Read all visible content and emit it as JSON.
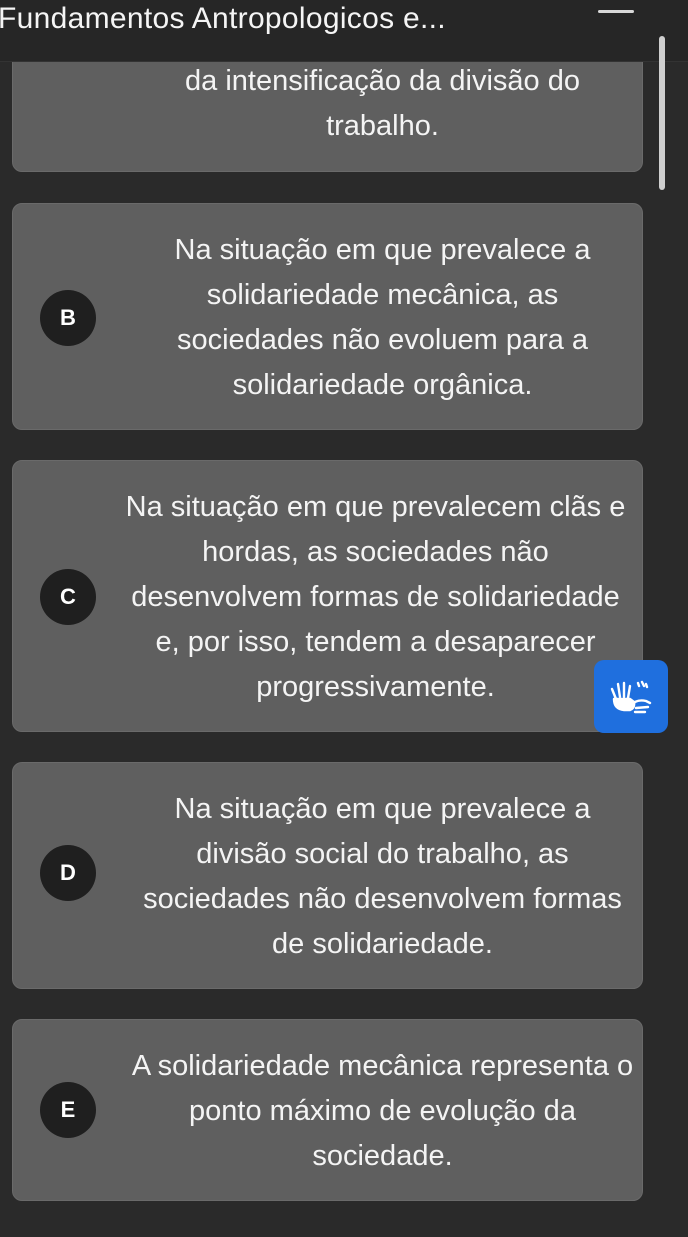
{
  "header": {
    "title": "Fundamentos Antropologicos e..."
  },
  "options": {
    "a": {
      "text": "da intensificação da divisão do trabalho."
    },
    "b": {
      "letter": "B",
      "text": "Na situação em que prevalece a solidariedade mecânica, as sociedades não evoluem para a solidariedade orgânica."
    },
    "c": {
      "letter": "C",
      "text": "Na situação em que prevalecem clãs e hordas, as sociedades não desenvolvem formas de solidariedade e, por isso, tendem a desaparecer progressivamente."
    },
    "d": {
      "letter": "D",
      "text": "Na situação em que prevalece a divisão social do trabalho, as sociedades não desenvolvem formas de solidariedade."
    },
    "e": {
      "letter": "E",
      "text": "A solidariedade mecânica representa o ponto máximo de evolução da sociedade."
    }
  },
  "accessibility": {
    "icon": "sign-language-hands-icon"
  },
  "colors": {
    "background": "#2a2a2a",
    "card": "#5f5f5f",
    "letter_circle": "#1f1f1f",
    "accessibility_button": "#1f6fde"
  }
}
